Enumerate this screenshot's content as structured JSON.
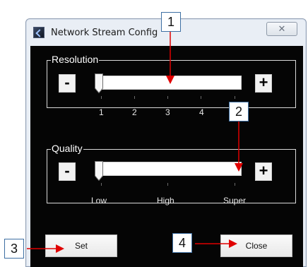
{
  "window": {
    "title": "Network Stream Config",
    "close_glyph": "✕"
  },
  "resolution": {
    "label": "Resolution",
    "minus": "-",
    "plus": "+",
    "ticks": [
      "1",
      "2",
      "3",
      "4"
    ]
  },
  "quality": {
    "label": "Quality",
    "minus": "-",
    "plus": "+",
    "ticks": [
      "Low",
      "High",
      "Super"
    ]
  },
  "buttons": {
    "set": "Set",
    "close": "Close"
  },
  "callouts": [
    "1",
    "2",
    "3",
    "4"
  ],
  "colors": {
    "callout_border": "#3d6fa3",
    "arrow_red": "#e00000",
    "client_background": "#050505"
  },
  "icons": {
    "app": "network-stream-app-icon",
    "close": "close-icon"
  }
}
